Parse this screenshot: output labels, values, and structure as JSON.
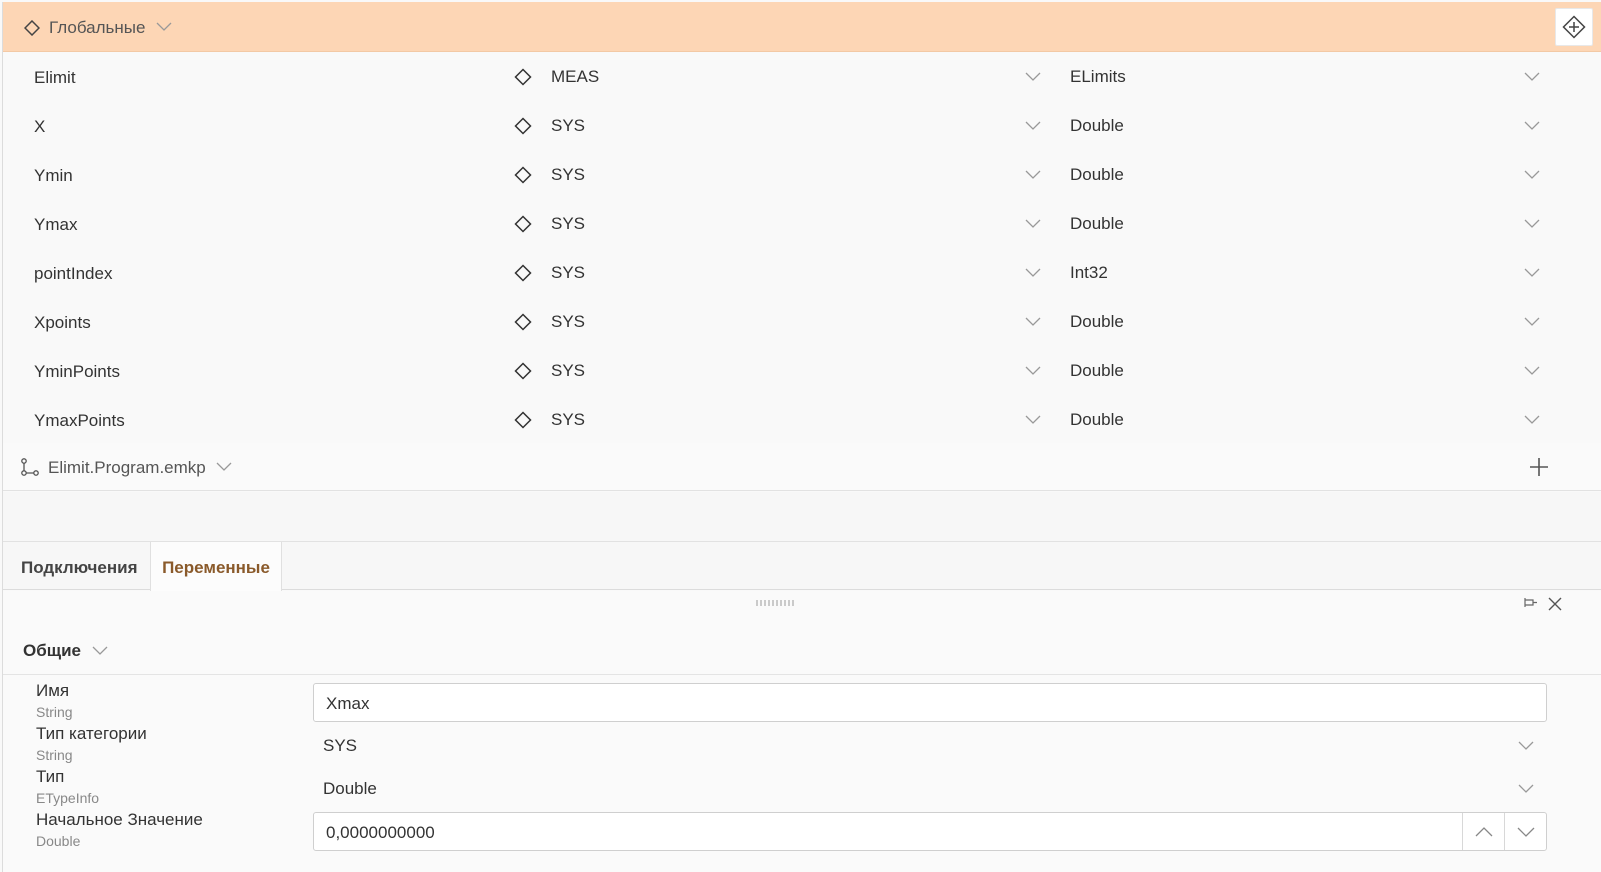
{
  "globals": {
    "title": "Глобальные",
    "variables": [
      {
        "name": "Elimit",
        "scope": "MEAS",
        "type": "ELimits"
      },
      {
        "name": "X",
        "scope": "SYS",
        "type": "Double"
      },
      {
        "name": "Ymin",
        "scope": "SYS",
        "type": "Double"
      },
      {
        "name": "Ymax",
        "scope": "SYS",
        "type": "Double"
      },
      {
        "name": "pointIndex",
        "scope": "SYS",
        "type": "Int32"
      },
      {
        "name": "Xpoints",
        "scope": "SYS",
        "type": "Double"
      },
      {
        "name": "YminPoints",
        "scope": "SYS",
        "type": "Double"
      },
      {
        "name": "YmaxPoints",
        "scope": "SYS",
        "type": "Double"
      }
    ]
  },
  "program": {
    "name": "Elimit.Program.emkp"
  },
  "tabs": {
    "connections": "Подключения",
    "variables": "Переменные"
  },
  "panel": {
    "section_title": "Общие",
    "name": {
      "label": "Имя",
      "type": "String",
      "value": "Xmax"
    },
    "category": {
      "label": "Тип категории",
      "type": "String",
      "value": "SYS"
    },
    "type": {
      "label": "Тип",
      "type": "ETypeInfo",
      "value": "Double"
    },
    "initial": {
      "label": "Начальное Значение",
      "type": "Double",
      "value": "0,0000000000"
    }
  },
  "colors": {
    "header_bg": "#fdd6b5",
    "active_tab_text": "#8a5a2b"
  }
}
